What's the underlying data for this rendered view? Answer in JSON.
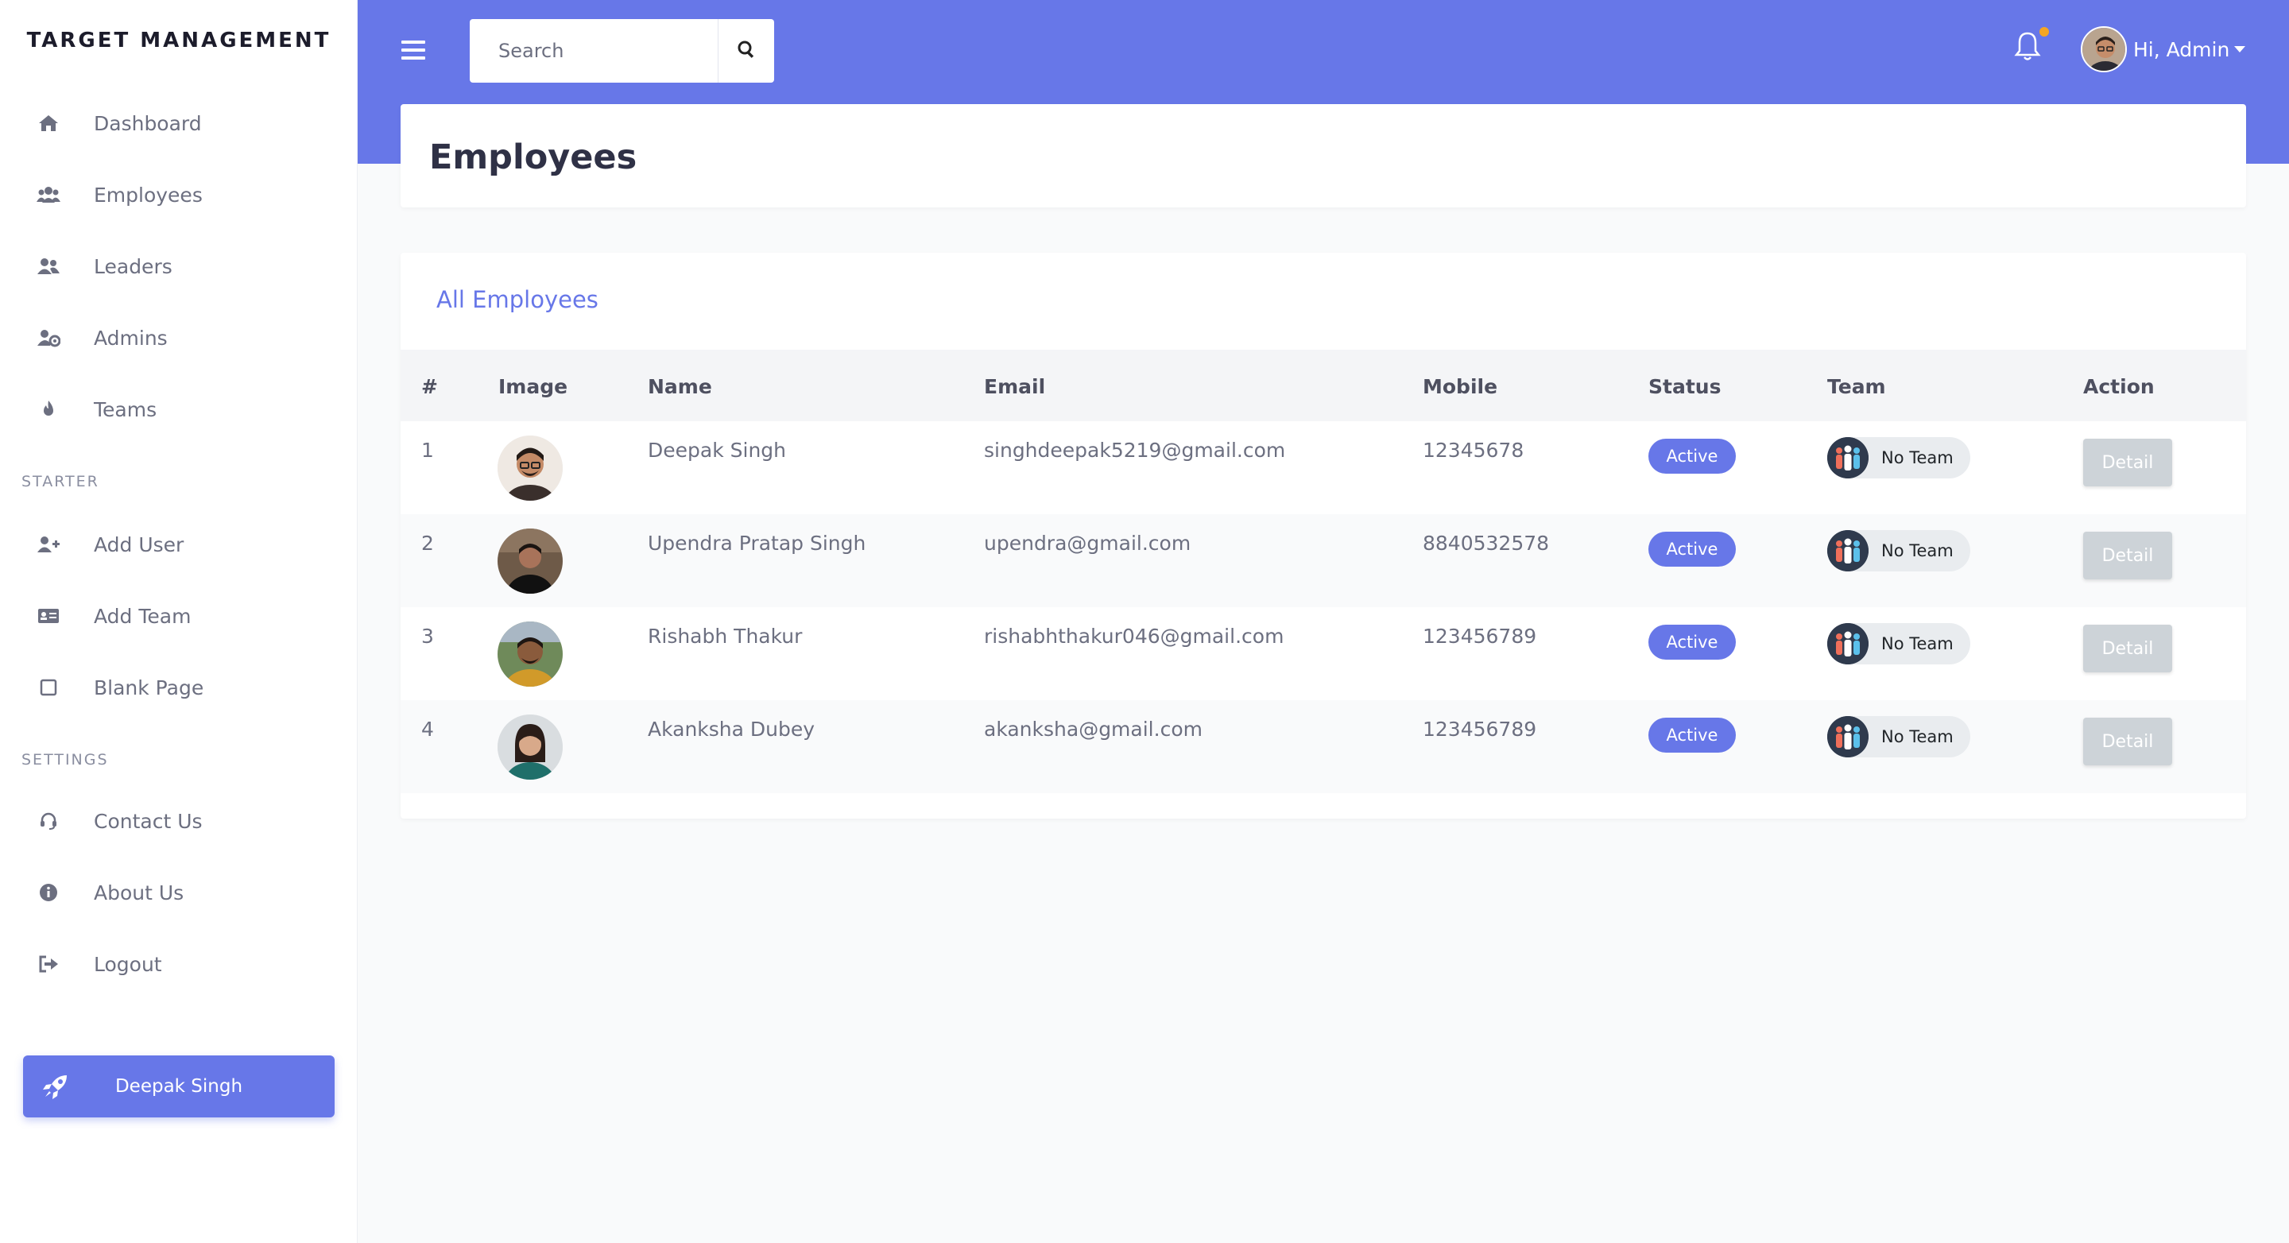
{
  "sidebar": {
    "brand": "TARGET MANAGEMENT",
    "nav": [
      {
        "label": "Dashboard",
        "icon": "home-icon"
      },
      {
        "label": "Employees",
        "icon": "users-icon"
      },
      {
        "label": "Leaders",
        "icon": "user-friends-icon"
      },
      {
        "label": "Admins",
        "icon": "user-cog-icon"
      },
      {
        "label": "Teams",
        "icon": "fire-icon"
      }
    ],
    "starter_label": "STARTER",
    "starter": [
      {
        "label": "Add User",
        "icon": "user-plus-icon"
      },
      {
        "label": "Add Team",
        "icon": "id-card-icon"
      },
      {
        "label": "Blank Page",
        "icon": "square-icon"
      }
    ],
    "settings_label": "SETTINGS",
    "settings": [
      {
        "label": "Contact Us",
        "icon": "headset-icon"
      },
      {
        "label": "About Us",
        "icon": "info-circle-icon"
      },
      {
        "label": "Logout",
        "icon": "sign-out-icon"
      }
    ],
    "cta_label": "Deepak Singh",
    "cta_icon": "rocket-icon"
  },
  "topbar": {
    "search_placeholder": "Search",
    "greeting": "Hi, Admin",
    "accent": "#6777e8",
    "notification_dot": "#f5a623"
  },
  "page": {
    "title": "Employees"
  },
  "table": {
    "title": "All Employees",
    "headers": [
      "#",
      "Image",
      "Name",
      "Email",
      "Mobile",
      "Status",
      "Team",
      "Action"
    ],
    "rows": [
      {
        "num": "1",
        "name": "Deepak Singh",
        "email": "singhdeepak5219@gmail.com",
        "mobile": "12345678",
        "status": "Active",
        "team": "No Team",
        "action": "Detail"
      },
      {
        "num": "2",
        "name": "Upendra Pratap Singh",
        "email": "upendra@gmail.com",
        "mobile": "8840532578",
        "status": "Active",
        "team": "No Team",
        "action": "Detail"
      },
      {
        "num": "3",
        "name": "Rishabh Thakur",
        "email": "rishabhthakur046@gmail.com",
        "mobile": "123456789",
        "status": "Active",
        "team": "No Team",
        "action": "Detail"
      },
      {
        "num": "4",
        "name": "Akanksha Dubey",
        "email": "akanksha@gmail.com",
        "mobile": "123456789",
        "status": "Active",
        "team": "No Team",
        "action": "Detail"
      }
    ]
  }
}
